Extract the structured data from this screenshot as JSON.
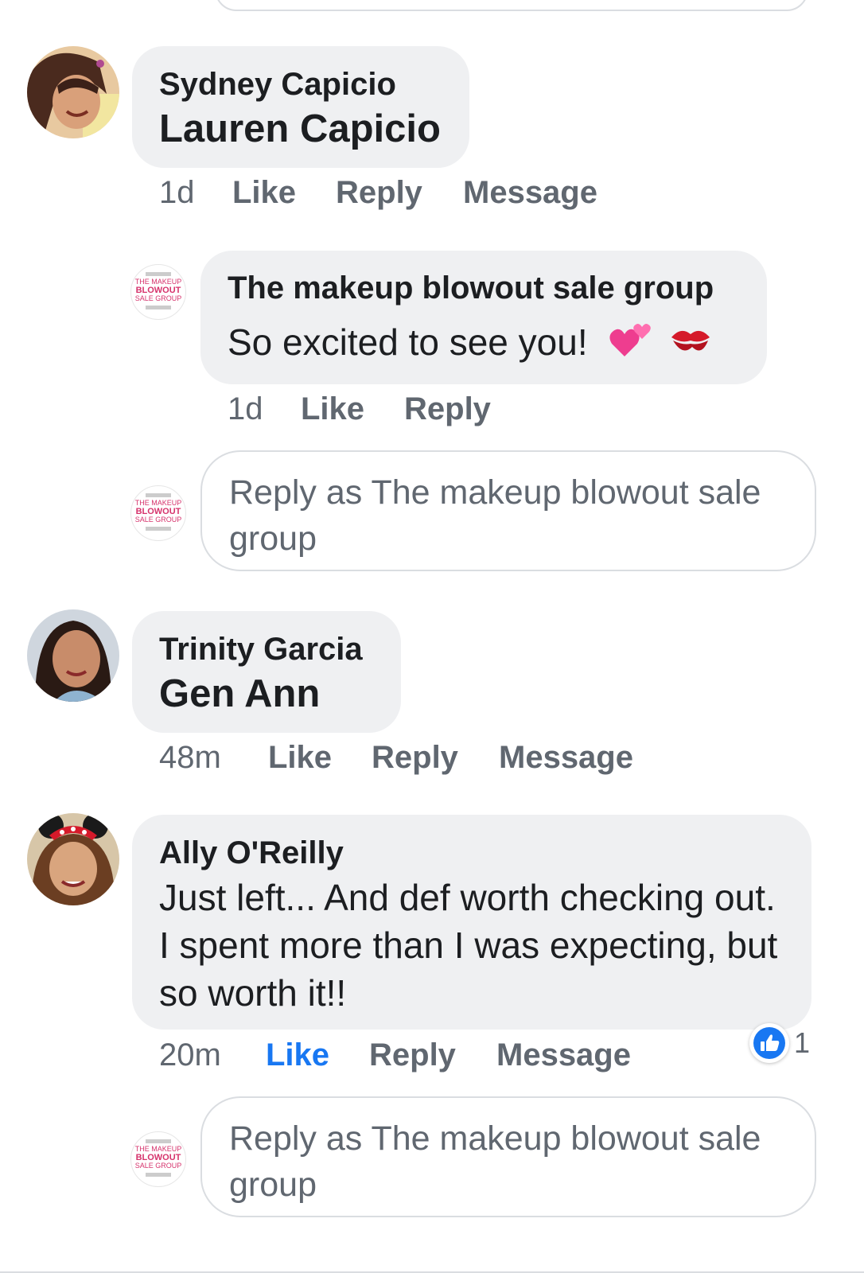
{
  "page_name": "The makeup blowout sale group",
  "logo_text": [
    "THE MAKEUP",
    "BLOWOUT",
    "SALE GROUP"
  ],
  "colors": {
    "link_blue": "#1877f2",
    "bubble_gray": "#eff0f2",
    "meta_gray": "#606770"
  },
  "comments": [
    {
      "author": "Sydney Capicio",
      "tag": "Lauren Capicio",
      "time": "1d",
      "like": "Like",
      "reply": "Reply",
      "message": "Message"
    },
    {
      "author": "Trinity Garcia",
      "tag": "Gen Ann",
      "time": "48m",
      "like": "Like",
      "reply": "Reply",
      "message": "Message"
    },
    {
      "author": "Ally O'Reilly",
      "text": "Just left... And def worth checking out.  I spent more than I was expecting, but so worth it!!",
      "time": "20m",
      "like": "Like",
      "reply": "Reply",
      "message": "Message",
      "reaction": {
        "icon": "thumbs-up-icon",
        "count": "1"
      }
    }
  ],
  "page_reply": {
    "author": "The makeup blowout sale group",
    "text": "So excited to see you!",
    "emoji": [
      "two-hearts-icon",
      "kiss-mark-icon"
    ],
    "time": "1d",
    "like": "Like",
    "reply": "Reply"
  },
  "reply_placeholder": "Reply as The makeup blowout sale group"
}
